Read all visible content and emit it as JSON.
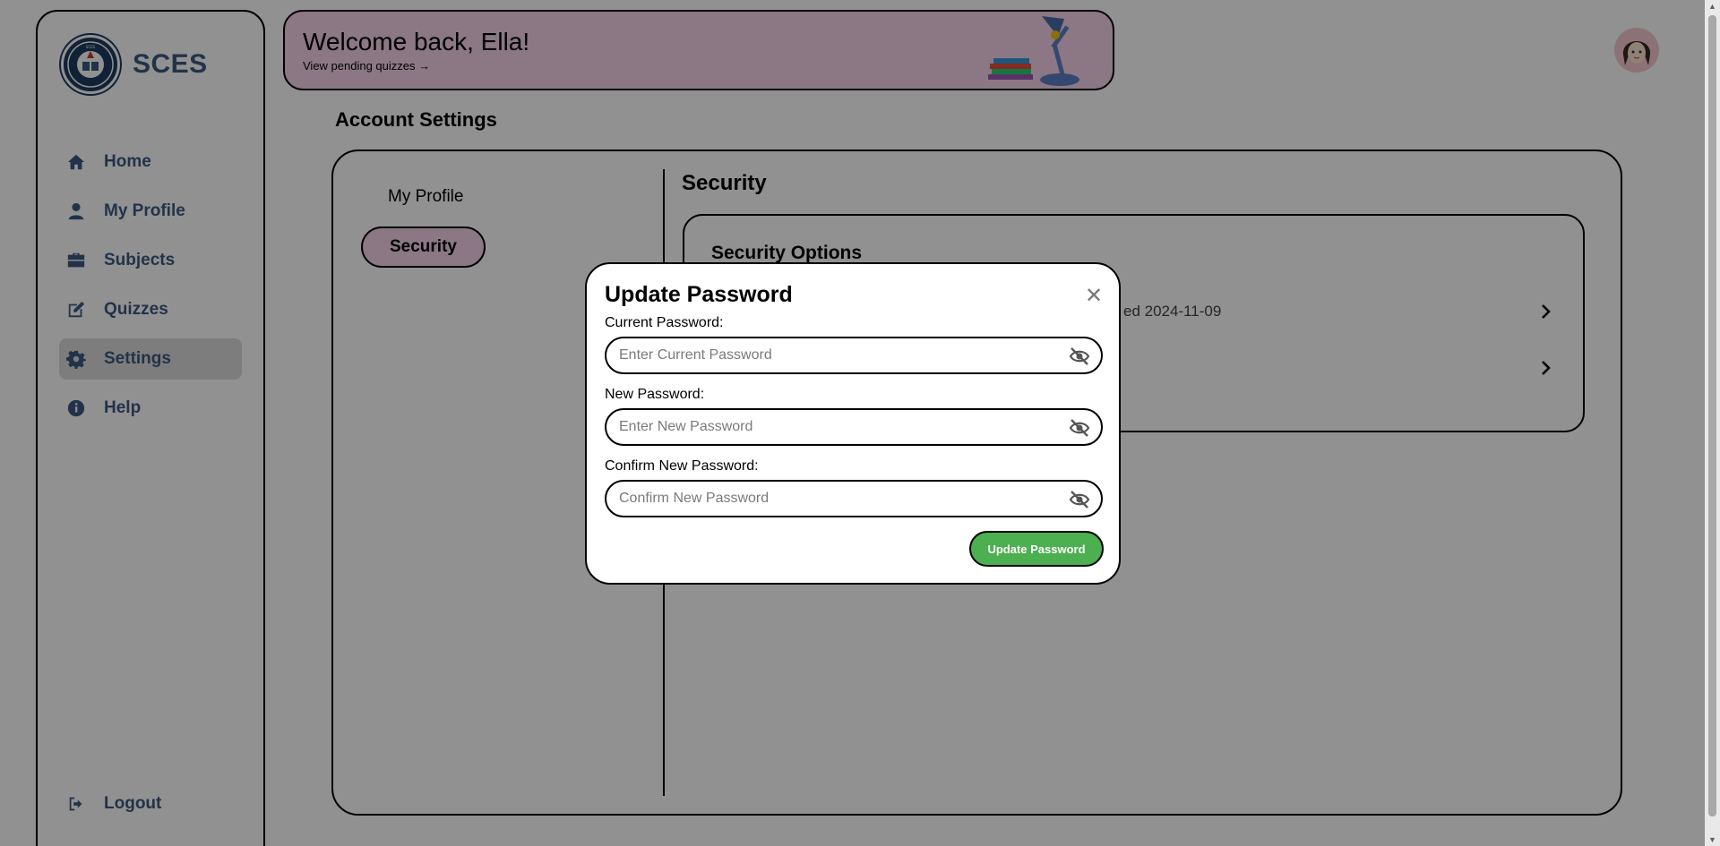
{
  "brand": {
    "name": "SCES",
    "logo_icon": "school-seal-icon"
  },
  "sidebar": {
    "items": [
      {
        "label": "Home",
        "icon": "home-icon",
        "active": false
      },
      {
        "label": "My Profile",
        "icon": "user-icon",
        "active": false
      },
      {
        "label": "Subjects",
        "icon": "briefcase-icon",
        "active": false
      },
      {
        "label": "Quizzes",
        "icon": "edit-icon",
        "active": false
      },
      {
        "label": "Settings",
        "icon": "gear-icon",
        "active": true
      },
      {
        "label": "Help",
        "icon": "info-icon",
        "active": false
      }
    ],
    "logout_label": "Logout"
  },
  "banner": {
    "welcome": "Welcome back, Ella!",
    "pending_link": "View pending quizzes →",
    "illustration": "desk-lamp-books-illustration"
  },
  "header": {
    "avatar_icon": "user-avatar-icon"
  },
  "page": {
    "title": "Account Settings"
  },
  "settings": {
    "tabs": [
      {
        "label": "My Profile",
        "active": false
      },
      {
        "label": "Security",
        "active": true
      }
    ],
    "section_title": "Security",
    "options_title": "Security Options",
    "options": [
      {
        "meta": "ed 2024-11-09"
      },
      {
        "meta": ""
      }
    ]
  },
  "modal": {
    "title": "Update Password",
    "close_icon": "close-icon",
    "fields": [
      {
        "label": "Current Password:",
        "placeholder": "Enter Current Password",
        "value": ""
      },
      {
        "label": "New Password:",
        "placeholder": "Enter New Password",
        "value": ""
      },
      {
        "label": "Confirm New Password:",
        "placeholder": "Confirm New Password",
        "value": ""
      }
    ],
    "submit_label": "Update Password"
  },
  "colors": {
    "brand_text": "#3d5a80",
    "banner_bg": "#f4d4e8",
    "submit_bg": "#4caf50",
    "overlay": "rgba(0,0,0,0.43)"
  }
}
